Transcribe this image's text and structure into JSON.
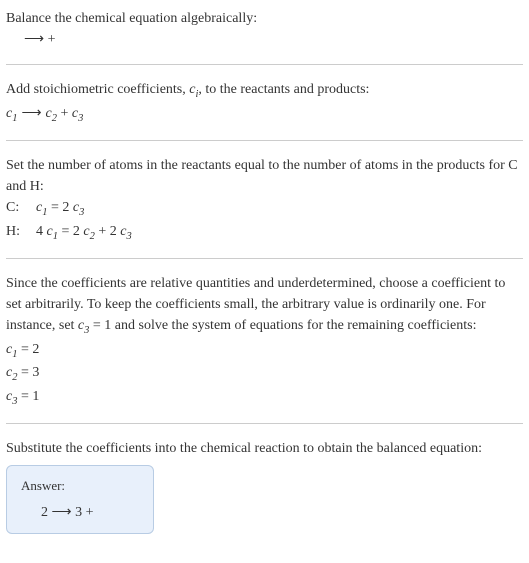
{
  "step1": {
    "title": "Balance the chemical equation algebraically:",
    "reaction": " ⟶  + "
  },
  "step2": {
    "title_before": "Add stoichiometric coefficients, ",
    "var": "c",
    "sub": "i",
    "title_after": ", to the reactants and products:",
    "reaction_c1": "c",
    "reaction_c1_sub": "1",
    "reaction_arrow": " ⟶ ",
    "reaction_c2": "c",
    "reaction_c2_sub": "2",
    "reaction_plus": "  + ",
    "reaction_c3": "c",
    "reaction_c3_sub": "3"
  },
  "step3": {
    "title": "Set the number of atoms in the reactants equal to the number of atoms in the products for C and H:",
    "rows": [
      {
        "label": "C: ",
        "lhs_c": "c",
        "lhs_sub": "1",
        "eq": " = 2 ",
        "rhs_c": "c",
        "rhs_sub": "3"
      },
      {
        "label": "H: ",
        "lhs_coef": "4 ",
        "lhs_c": "c",
        "lhs_sub": "1",
        "eq": " = 2 ",
        "mid_c": "c",
        "mid_sub": "2",
        "plus": " + 2 ",
        "rhs_c": "c",
        "rhs_sub": "3"
      }
    ]
  },
  "step4": {
    "title_p1": "Since the coefficients are relative quantities and underdetermined, choose a coefficient to set arbitrarily. To keep the coefficients small, the arbitrary value is ordinarily one. For instance, set ",
    "set_c": "c",
    "set_sub": "3",
    "title_p2": " = 1 and solve the system of equations for the remaining coefficients:",
    "assignments": [
      {
        "c": "c",
        "sub": "1",
        "val": " = 2"
      },
      {
        "c": "c",
        "sub": "2",
        "val": " = 3"
      },
      {
        "c": "c",
        "sub": "3",
        "val": " = 1"
      }
    ]
  },
  "step5": {
    "title": "Substitute the coefficients into the chemical reaction to obtain the balanced equation:",
    "answer_label": "Answer:",
    "answer_eq": "2  ⟶ 3  + "
  }
}
